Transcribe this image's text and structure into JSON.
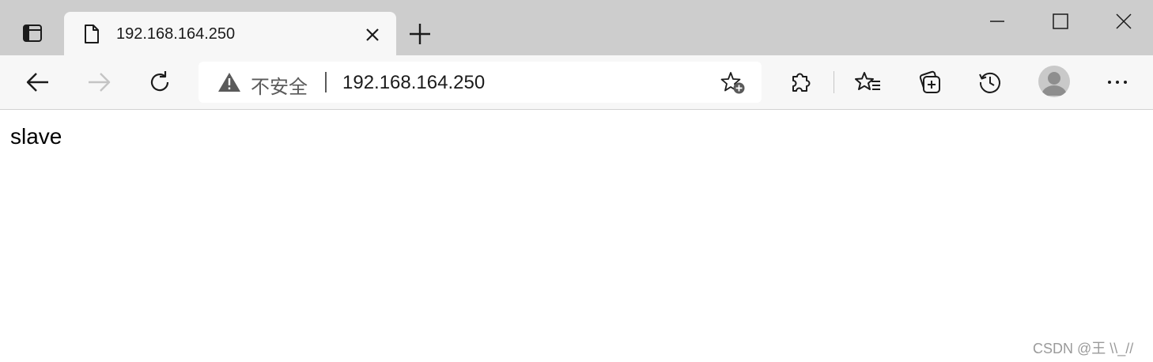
{
  "tab": {
    "title": "192.168.164.250",
    "favicon": "page-icon",
    "close_icon": "close-icon"
  },
  "window_controls": [
    "minimize-icon",
    "maximize-icon",
    "close-icon"
  ],
  "toolbar": {
    "back": "back-arrow-icon",
    "forward": "forward-arrow-icon",
    "refresh": "refresh-icon",
    "extensions": "puzzle-icon",
    "favorites": "favorites-icon",
    "collections": "collections-icon",
    "history": "history-icon",
    "profile": "avatar",
    "more": "more-icon"
  },
  "address": {
    "security_label": "不安全",
    "url": "192.168.164.250",
    "add_favorite": "star-plus-icon"
  },
  "page": {
    "body_text": "slave"
  },
  "watermark": "CSDN @王 \\\\_//",
  "colors": {
    "titlebar": "#cdcdcd",
    "toolbar": "#f7f7f7",
    "active_tab": "#f7f7f7"
  }
}
